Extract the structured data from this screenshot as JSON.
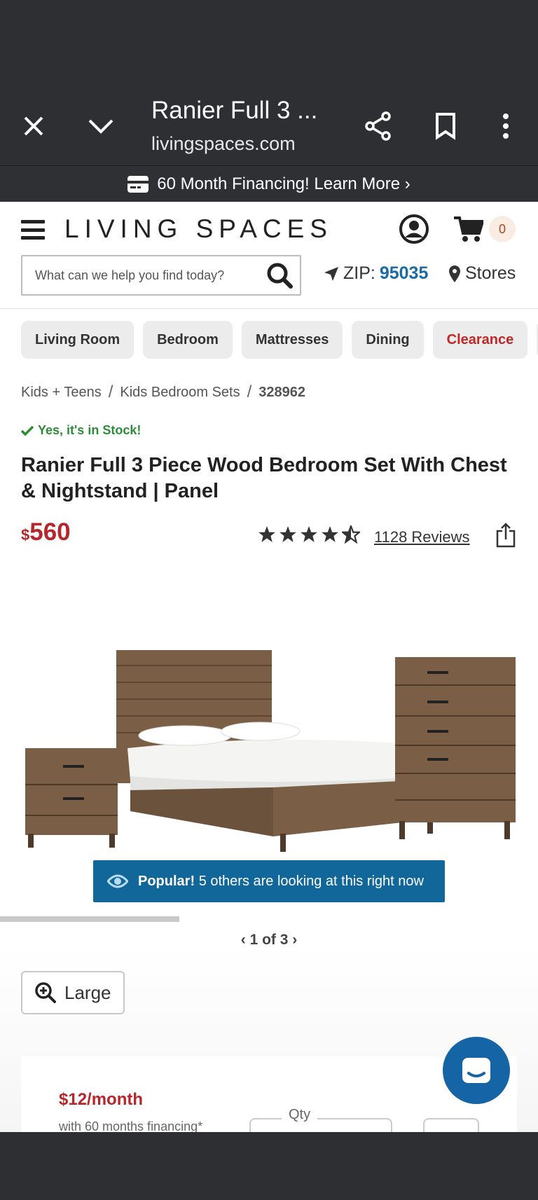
{
  "browser": {
    "title": "Ranier Full 3 ...",
    "url": "livingspaces.com",
    "close_icon": "close-icon",
    "collapse_icon": "chevron-down-icon",
    "share_icon": "share-icon",
    "bookmark_icon": "bookmark-icon",
    "menu_icon": "more-vertical-icon"
  },
  "promo": {
    "text": "60 Month Financing! Learn More ›",
    "icon": "credit-card-icon"
  },
  "header": {
    "logo": "LIVING SPACES",
    "cart_count": "0"
  },
  "search": {
    "placeholder": "What can we help you find today?"
  },
  "location": {
    "zip_label": "ZIP:",
    "zip_value": "95035",
    "stores_label": "Stores"
  },
  "categories": [
    "Living Room",
    "Bedroom",
    "Mattresses",
    "Dining",
    "Clearance"
  ],
  "breadcrumb": {
    "items": [
      "Kids + Teens",
      "Kids Bedroom Sets"
    ],
    "current": "328962"
  },
  "product": {
    "stock_status": "Yes, it's in Stock!",
    "title": "Ranier Full 3 Piece Wood Bedroom Set With Chest & Nightstand | Panel",
    "price_currency": "$",
    "price_amount": "560",
    "rating": 4.5,
    "reviews_label": "1128 Reviews",
    "colors": {
      "price": "#b7262a",
      "stock": "#2f8a39",
      "accent": "#11669a"
    }
  },
  "gallery": {
    "popular_bold": "Popular!",
    "popular_text": "5 others are looking at this right now",
    "pager": "1 of 3",
    "progress_fraction": 0.333
  },
  "zoom": {
    "label": "Large"
  },
  "financing": {
    "monthly": "$12/month",
    "note": "with 60 months financing*",
    "qty_label": "Qty"
  }
}
